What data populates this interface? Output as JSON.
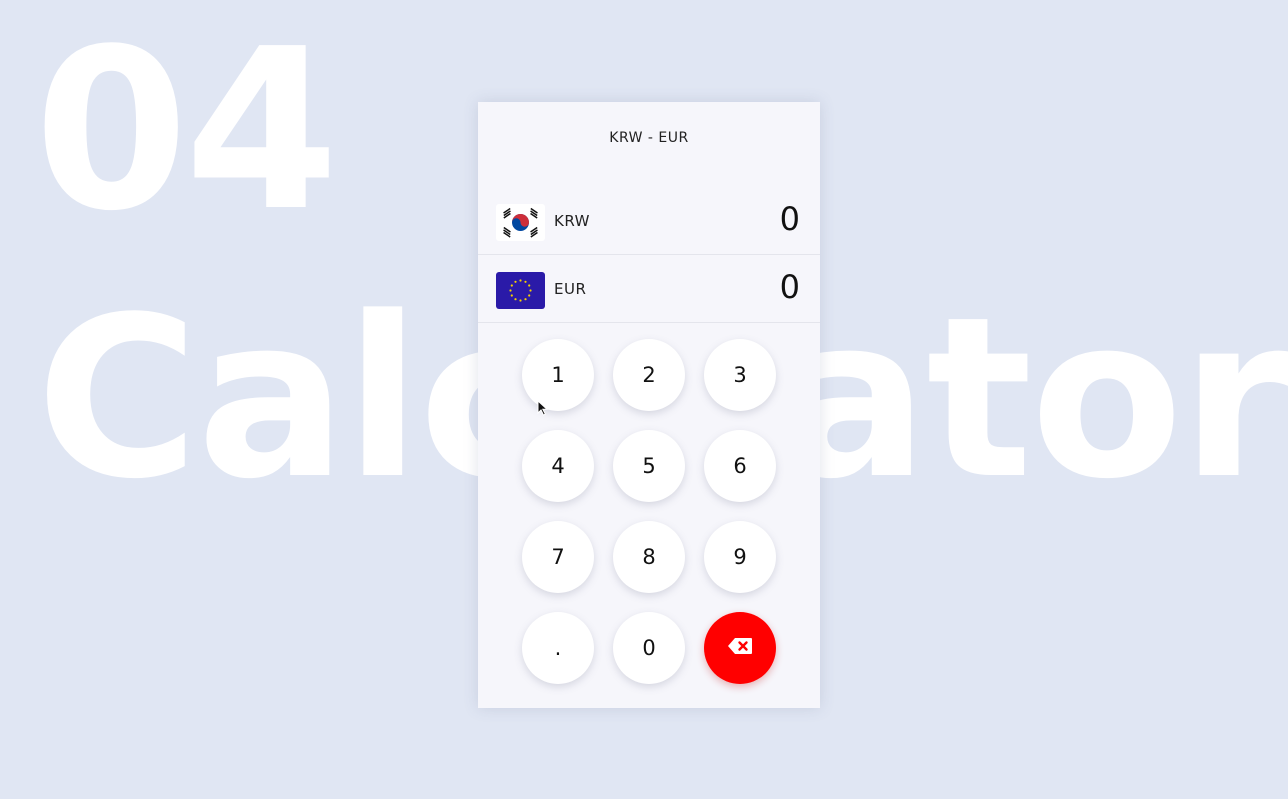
{
  "background": {
    "number": "04",
    "word": "Calculator"
  },
  "header": {
    "title": "KRW - EUR"
  },
  "currencies": [
    {
      "code": "KRW",
      "value": "0",
      "flag": "south-korea-flag-icon"
    },
    {
      "code": "EUR",
      "value": "0",
      "flag": "eu-flag-icon"
    }
  ],
  "keypad": {
    "keys": [
      "1",
      "2",
      "3",
      "4",
      "5",
      "6",
      "7",
      "8",
      "9",
      ".",
      "0"
    ],
    "delete_icon": "backspace-icon",
    "delete_color": "#ff0000"
  },
  "colors": {
    "background": "#e0e6f3",
    "panel": "#f6f6fb",
    "accent": "#ff0000"
  }
}
